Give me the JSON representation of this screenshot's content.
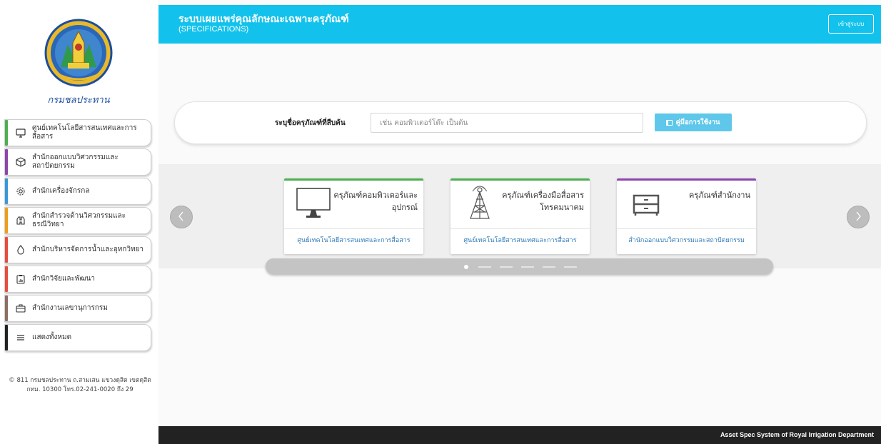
{
  "header": {
    "title": "ระบบเผยแพร่คุณลักษณะเฉพาะครุภัณฑ์",
    "subtitle": "(SPECIFICATIONS)",
    "login_label": "เข้าสู่ระบบ",
    "accent_color": "#12c2ec"
  },
  "logo": {
    "text": "กรมชลประทาน"
  },
  "sidebar": {
    "items": [
      {
        "label": "ศูนย์เทคโนโลยีสารสนเทศและการสื่อสาร",
        "icon": "monitor-icon",
        "color": "#4caf50"
      },
      {
        "label": "สำนักออกแบบวิศวกรรมและสถาปัตยกรรม",
        "icon": "cube-icon",
        "color": "#8e44ad"
      },
      {
        "label": "สำนักเครื่องจักรกล",
        "icon": "gear-icon",
        "color": "#3498db"
      },
      {
        "label": "สำนักสำรวจด้านวิศวกรรมและธรณีวิทยา",
        "icon": "binoculars-icon",
        "color": "#f39c12"
      },
      {
        "label": "สำนักบริหารจัดการน้ำและอุทกวิทยา",
        "icon": "water-drop-icon",
        "color": "#e74c3c"
      },
      {
        "label": "สำนักวิจัยและพัฒนา",
        "icon": "clipboard-chart-icon",
        "color": "#e74c3c"
      },
      {
        "label": "สำนักงานเลขานุการกรม",
        "icon": "briefcase-icon",
        "color": "#8d6e63"
      },
      {
        "label": "แสดงทั้งหมด",
        "icon": "menu-icon",
        "color": "#222222"
      }
    ],
    "footer_line1": "© 811 กรมชลประทาน ถ.สามเสน แขวงดุสิต เขตดุสิต",
    "footer_line2": "กทม. 10300 โทร.02-241-0020 ถึง 29"
  },
  "search": {
    "label": "ระบุชื่อครุภัณฑ์ที่สืบค้น",
    "placeholder": "เช่น คอมพิวเตอร์โต๊ะ เป็นต้น",
    "value": "",
    "manual_label": "คู่มือการใช้งาน"
  },
  "carousel": {
    "cards": [
      {
        "title": "ครุภัณฑ์คอมพิวเตอร์และอุปกรณ์",
        "link": "ศูนย์เทคโนโลยีสารสนเทศและการสื่อสาร",
        "icon": "computer-monitor-icon",
        "color": "#4caf50"
      },
      {
        "title": "ครุภัณฑ์เครื่องมือสื่อสารโทรคมนาคม",
        "link": "ศูนย์เทคโนโลยีสารสนเทศและการสื่อสาร",
        "icon": "antenna-tower-icon",
        "color": "#4caf50"
      },
      {
        "title": "ครุภัณฑ์สำนักงาน",
        "link": "สำนักออกแบบวิศวกรรมและสถาปัตยกรรม",
        "icon": "drawer-cabinet-icon",
        "color": "#8e44ad"
      }
    ],
    "prev_icon": "chevron-left-icon",
    "next_icon": "chevron-right-icon",
    "active_page": 1,
    "page_count": 6
  },
  "footer": {
    "text": "Asset Spec System of Royal Irrigation Department"
  }
}
